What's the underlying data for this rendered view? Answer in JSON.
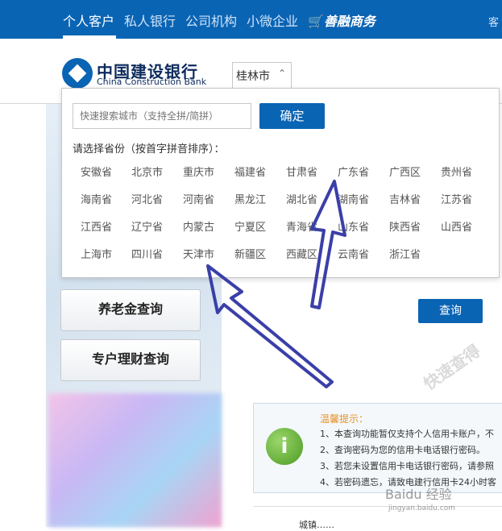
{
  "topnav": {
    "items": [
      {
        "label": "个人客户",
        "active": true
      },
      {
        "label": "私人银行",
        "active": false
      },
      {
        "label": "公司机构",
        "active": false
      },
      {
        "label": "小微企业",
        "active": false
      }
    ],
    "shop_label": "善融商务",
    "right_cut": "客"
  },
  "logo": {
    "cn": "中国建设银行",
    "en": "China Construction Bank"
  },
  "city_select": {
    "value": "桂林市"
  },
  "city_dropdown": {
    "search_placeholder": "快速搜索城市（支持全拼/简拼）",
    "confirm_label": "确定",
    "hint": "请选择省份（按首字拼音排序）：",
    "provinces": [
      [
        "安徽省",
        "北京市",
        "重庆市",
        "福建省",
        "甘肃省",
        "广东省",
        "广西区",
        "贵州省"
      ],
      [
        "海南省",
        "河北省",
        "河南省",
        "黑龙江",
        "湖北省",
        "湖南省",
        "吉林省",
        "江苏省"
      ],
      [
        "江西省",
        "辽宁省",
        "内蒙古",
        "宁夏区",
        "青海省",
        "山东省",
        "陕西省",
        "山西省"
      ],
      [
        "上海市",
        "四川省",
        "天津市",
        "新疆区",
        "西藏区",
        "云南省",
        "浙江省"
      ]
    ]
  },
  "sidebar": {
    "buttons": [
      "养老金查询",
      "专户理财查询"
    ]
  },
  "query_button": "查询",
  "tips": {
    "title": "温馨提示：",
    "lines": [
      "1、本查询功能暂仅支持个人信用卡账户，不",
      "2、查询密码为您的信用卡电话银行密码。",
      "3、若您未设置信用卡电话银行密码，请参照",
      "4、若密码遗忘，请致电建行信用卡24小时客"
    ]
  },
  "bottom_text": "城镇……",
  "watermarks": {
    "brand": "Baidu 经验",
    "url": "jingyan.baidu.com",
    "overlay": "快速查得"
  },
  "colors": {
    "brand_blue": "#0a64b4",
    "arrow": "#3a3fa8",
    "tip_title": "#e6902a"
  }
}
